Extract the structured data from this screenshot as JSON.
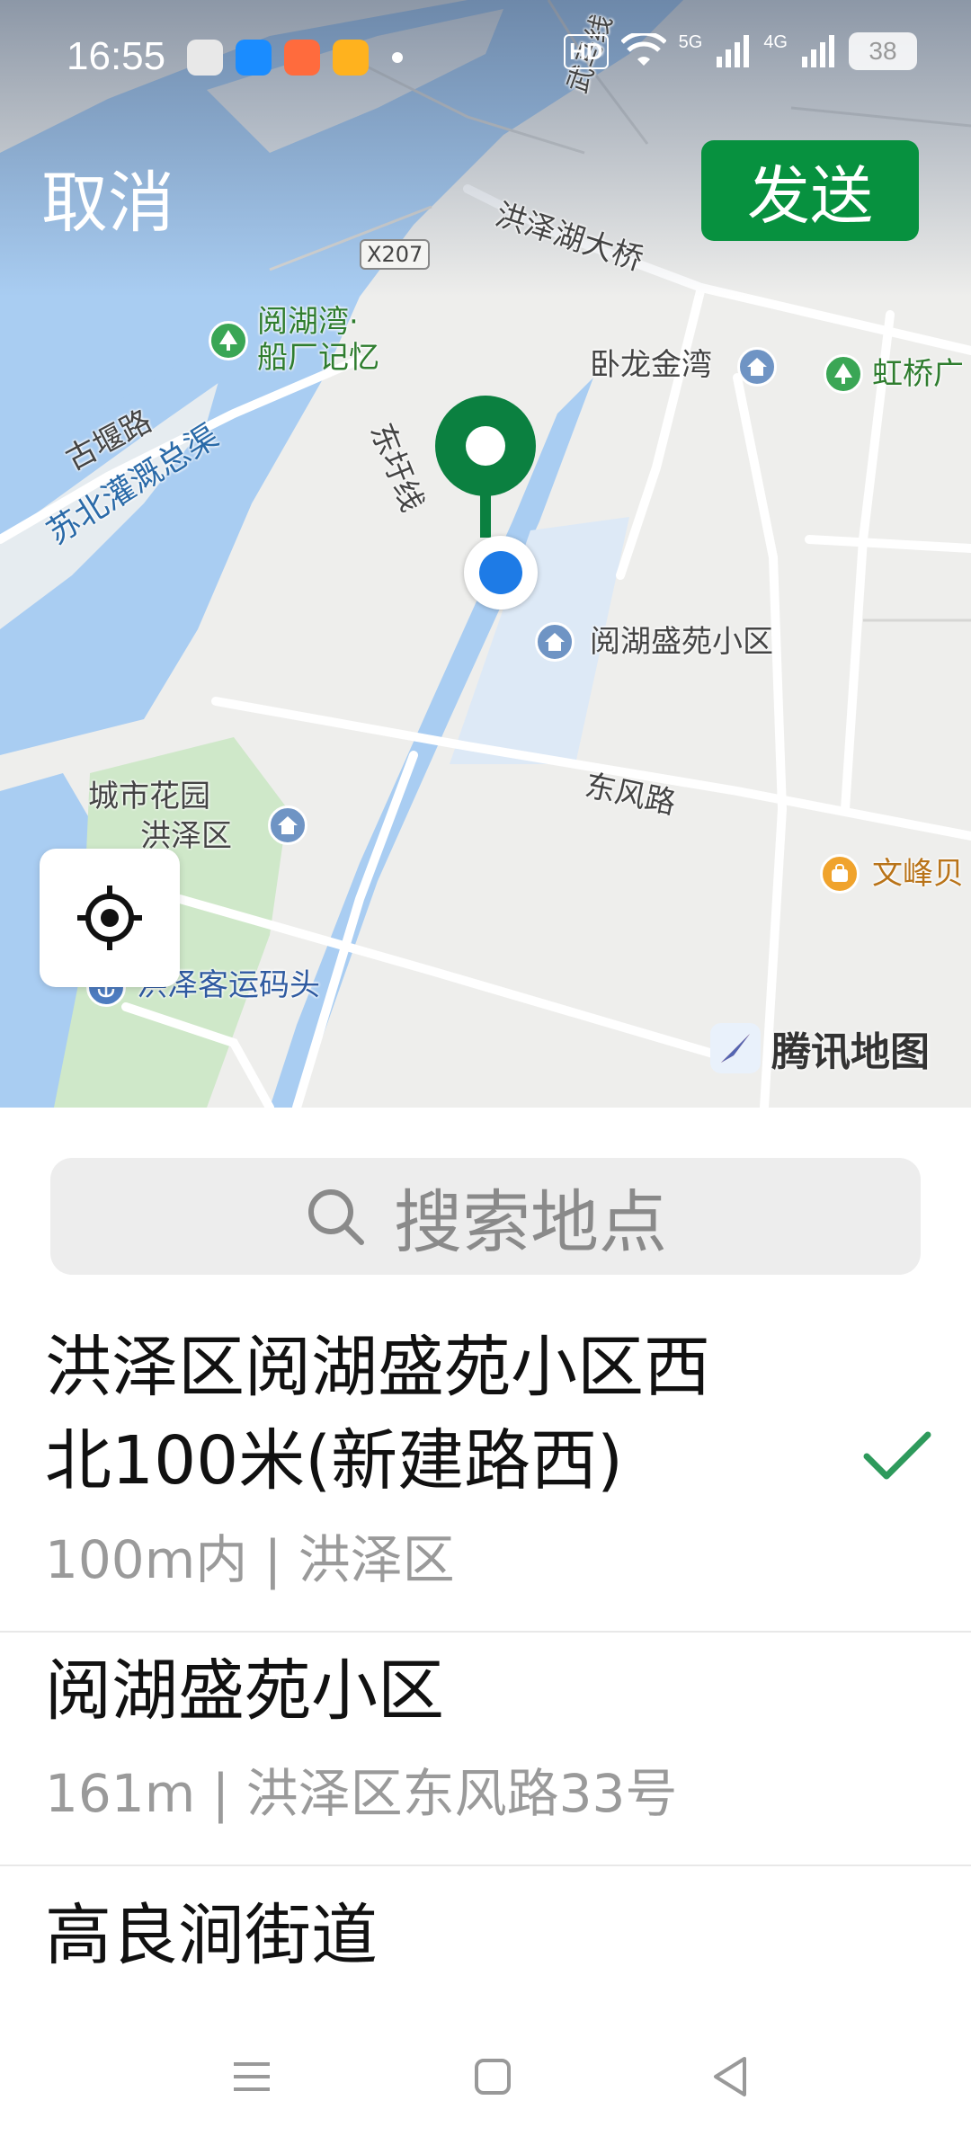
{
  "status_bar": {
    "time": "16:55",
    "hd": "HD",
    "net1": "5G",
    "net2": "4G",
    "battery": "38"
  },
  "header": {
    "cancel_label": "取消",
    "send_label": "发送"
  },
  "map": {
    "labels": {
      "road_wuma": "武马线",
      "bridge": "洪泽湖大桥",
      "x207": "X207",
      "poi_yuehu_line1": "阅湖湾·",
      "poi_yuehu_line2": "船厂记忆",
      "wolong": "卧龙金湾",
      "hongqiao": "虹桥广",
      "guyanlu": "古堰路",
      "dongyu_line": "东圩线",
      "canal": "苏北灌溉总渠",
      "community": "阅湖盛苑小区",
      "dongfenglu": "东风路",
      "garden_line1": "城市花园",
      "garden_line2": "洪泽区",
      "wenfeng": "文峰贝",
      "pier": "洪泽客运码头"
    },
    "brand": "腾讯地图"
  },
  "search": {
    "placeholder": "搜索地点"
  },
  "places": [
    {
      "title_line1": "洪泽区阅湖盛苑小区西",
      "title_line2": "北100米(新建路西)",
      "subtitle": "100m内 | 洪泽区",
      "selected": true
    },
    {
      "title_line1": "阅湖盛苑小区",
      "subtitle": "161m | 洪泽区东风路33号"
    },
    {
      "title_line1": "高良涧街道"
    }
  ],
  "colors": {
    "accent": "#07913f",
    "check": "#2e9a5c",
    "pin_green": "#0b8040",
    "location_blue": "#1e7be6",
    "water": "#a9cdf2",
    "park": "#cfe8c9"
  }
}
